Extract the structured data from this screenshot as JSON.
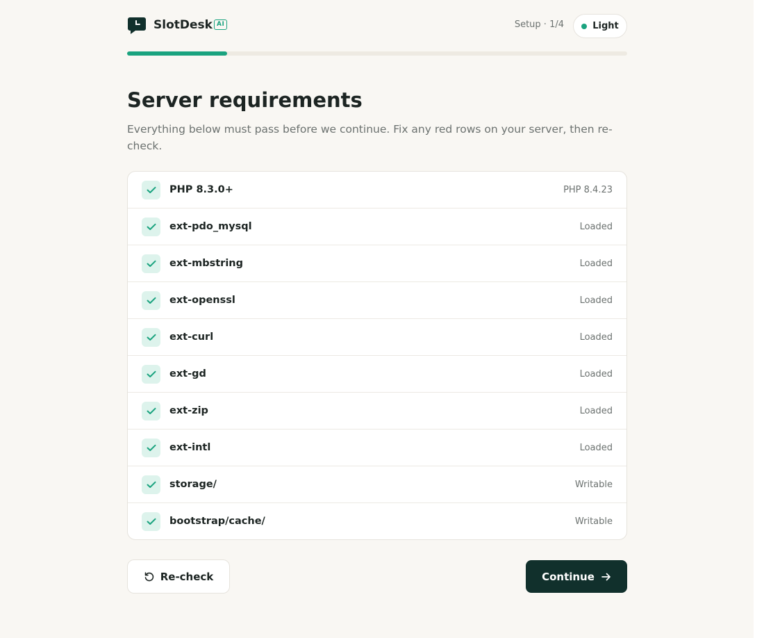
{
  "header": {
    "brand": "SlotDesk",
    "badge": "AI",
    "step": "Setup · 1/4",
    "theme_label": "Light"
  },
  "progress": {
    "fraction": 0.2
  },
  "main": {
    "title": "Server requirements",
    "subtitle": "Everything below must pass before we continue. Fix any red rows on your server, then re-check."
  },
  "requirements": [
    {
      "label": "PHP 8.3.0+",
      "status": "PHP 8.4.23",
      "passed": true
    },
    {
      "label": "ext-pdo_mysql",
      "status": "Loaded",
      "passed": true
    },
    {
      "label": "ext-mbstring",
      "status": "Loaded",
      "passed": true
    },
    {
      "label": "ext-openssl",
      "status": "Loaded",
      "passed": true
    },
    {
      "label": "ext-curl",
      "status": "Loaded",
      "passed": true
    },
    {
      "label": "ext-gd",
      "status": "Loaded",
      "passed": true
    },
    {
      "label": "ext-zip",
      "status": "Loaded",
      "passed": true
    },
    {
      "label": "ext-intl",
      "status": "Loaded",
      "passed": true
    },
    {
      "label": "storage/",
      "status": "Writable",
      "passed": true
    },
    {
      "label": "bootstrap/cache/",
      "status": "Writable",
      "passed": true
    }
  ],
  "actions": {
    "recheck_label": "Re-check",
    "continue_label": "Continue"
  },
  "colors": {
    "accent": "#1aa37f",
    "dark": "#11302c",
    "background": "#f9f7f3"
  }
}
